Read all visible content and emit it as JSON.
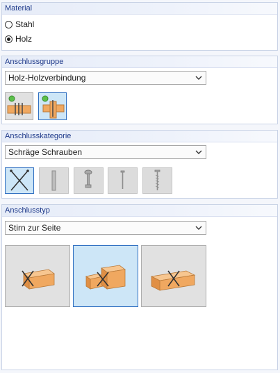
{
  "material": {
    "title": "Material",
    "options": [
      {
        "label": "Stahl",
        "selected": false
      },
      {
        "label": "Holz",
        "selected": true
      }
    ]
  },
  "anschlussgruppe": {
    "title": "Anschlussgruppe",
    "selected_value": "Holz-Holzverbindung",
    "buttons": [
      {
        "icon": "wood-wood-connection-icon",
        "selected": false
      },
      {
        "icon": "wood-wood-cross-connection-icon",
        "selected": true
      }
    ]
  },
  "anschlusskategorie": {
    "title": "Anschlusskategorie",
    "selected_value": "Schräge Schrauben",
    "buttons": [
      {
        "icon": "inclined-screws-icon",
        "selected": true,
        "enabled": true
      },
      {
        "icon": "dowel-icon",
        "selected": false,
        "enabled": false
      },
      {
        "icon": "bolt-icon",
        "selected": false,
        "enabled": false
      },
      {
        "icon": "nail-icon",
        "selected": false,
        "enabled": false
      },
      {
        "icon": "screw-icon",
        "selected": false,
        "enabled": false
      }
    ]
  },
  "anschlusstyp": {
    "title": "Anschlusstyp",
    "selected_value": "Stirn zur Seite",
    "buttons": [
      {
        "icon": "beam-end-screws-icon",
        "selected": false
      },
      {
        "icon": "end-to-side-screws-icon",
        "selected": true
      },
      {
        "icon": "beam-side-screws-icon",
        "selected": false
      }
    ]
  },
  "colors": {
    "header_text": "#1f3a8a",
    "selected_bg": "#cde6f7",
    "selected_border": "#2f6fc1",
    "wood": "#f0a860"
  }
}
